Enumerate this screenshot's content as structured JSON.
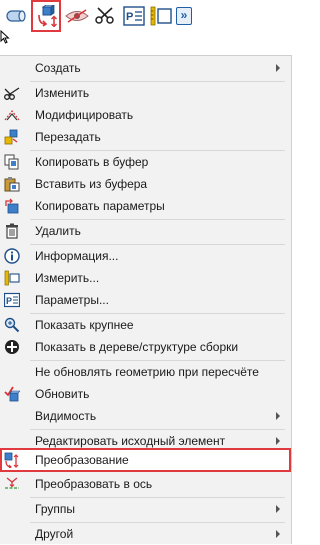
{
  "toolbar": {
    "buttons": [
      {
        "name": "extrude-tool-icon",
        "active": false
      },
      {
        "name": "transform-tool-icon",
        "active": true
      },
      {
        "name": "hide-tool-icon",
        "active": false
      },
      {
        "name": "scissors-tool-icon",
        "active": false
      },
      {
        "name": "parameters-tool-icon",
        "active": false
      },
      {
        "name": "measure-tool-icon",
        "active": false
      },
      {
        "name": "more-chevron-icon",
        "active": false
      }
    ],
    "more_glyph": "»"
  },
  "menu": {
    "items": [
      {
        "label": "Создать",
        "icon": "",
        "submenu": true
      },
      {
        "label": "Изменить",
        "icon": "scissors-icon",
        "submenu": false
      },
      {
        "label": "Модифицировать",
        "icon": "modify-icon",
        "submenu": false
      },
      {
        "label": "Перезадать",
        "icon": "redefine-icon",
        "submenu": false
      },
      {
        "label": "Копировать в буфер",
        "icon": "copy-icon",
        "submenu": false
      },
      {
        "label": "Вставить из буфера",
        "icon": "paste-icon",
        "submenu": false
      },
      {
        "label": "Копировать параметры",
        "icon": "copy-params-icon",
        "submenu": false
      },
      {
        "label": "Удалить",
        "icon": "trash-icon",
        "submenu": false
      },
      {
        "label": "Информация...",
        "icon": "info-icon",
        "submenu": false
      },
      {
        "label": "Измерить...",
        "icon": "measure-icon",
        "submenu": false
      },
      {
        "label": "Параметры...",
        "icon": "parameters-icon",
        "submenu": false
      },
      {
        "label": "Показать крупнее",
        "icon": "zoom-icon",
        "submenu": false
      },
      {
        "label": "Показать в дереве/структуре сборки",
        "icon": "locate-in-tree-icon",
        "submenu": false
      },
      {
        "label": "Не обновлять геометрию при пересчёте",
        "icon": "",
        "submenu": false
      },
      {
        "label": "Обновить",
        "icon": "update-icon",
        "submenu": false
      },
      {
        "label": "Видимость",
        "icon": "",
        "submenu": true
      },
      {
        "label": "Редактировать исходный элемент",
        "icon": "",
        "submenu": true
      },
      {
        "label": "Преобразование",
        "icon": "transform-icon",
        "submenu": false,
        "highlighted": true
      },
      {
        "label": "Преобразовать в ось",
        "icon": "convert-to-axis-icon",
        "submenu": false
      },
      {
        "label": "Группы",
        "icon": "",
        "submenu": true
      },
      {
        "label": "Другой",
        "icon": "",
        "submenu": true
      }
    ]
  },
  "colors": {
    "highlight_border": "#e0393e",
    "menu_background": "#f2f2f2",
    "icon_blue": "#1f5fa8",
    "icon_red": "#d8343a",
    "icon_yellow": "#e8b800"
  }
}
